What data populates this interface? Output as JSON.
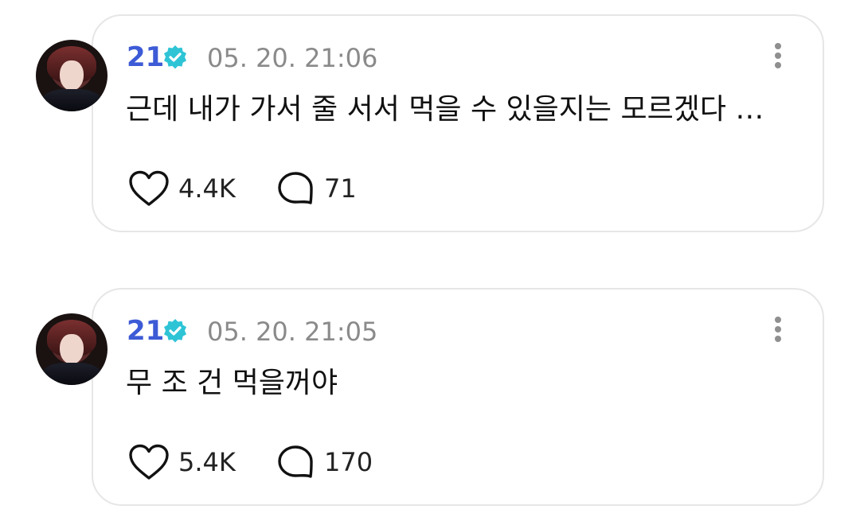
{
  "posts": [
    {
      "author": "21",
      "verified": true,
      "timestamp": "05. 20. 21:06",
      "text": "근데 내가 가서 줄 서서 먹을 수 있을지는 모르겠다 …",
      "likes": "4.4K",
      "comments": "71"
    },
    {
      "author": "21",
      "verified": true,
      "timestamp": "05. 20. 21:05",
      "text": "무 조 건 먹을꺼야",
      "likes": "5.4K",
      "comments": "170"
    }
  ],
  "icons": {
    "verified": "verified-badge-icon",
    "more": "more-vertical-icon",
    "like": "heart-icon",
    "comment": "comment-bubble-icon"
  },
  "colors": {
    "author_name": "#3d5bd6",
    "verified_badge": "#2ec4d6",
    "timestamp": "#8a8a8a",
    "card_border": "#e6e6e6"
  }
}
